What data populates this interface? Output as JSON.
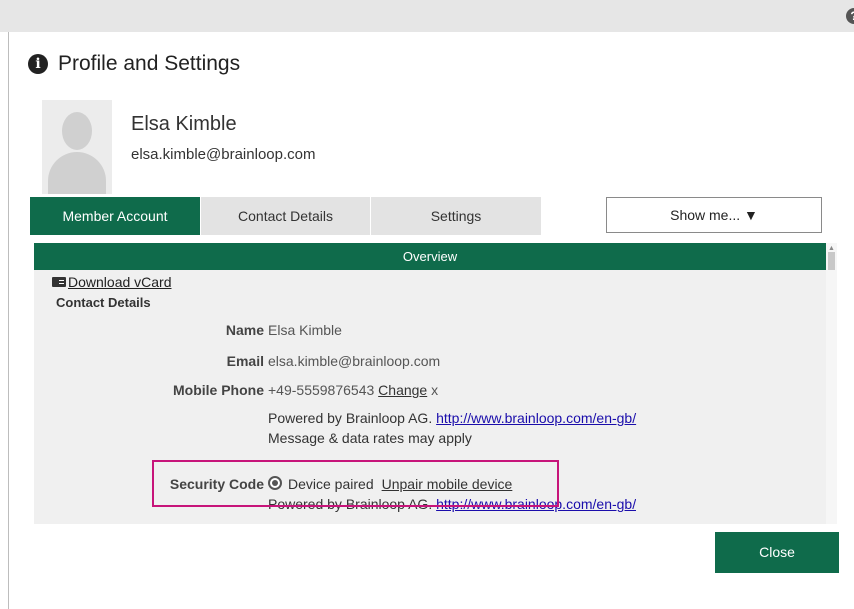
{
  "dialog": {
    "title": "Profile and Settings",
    "help_icon": "?"
  },
  "user": {
    "name": "Elsa Kimble",
    "email": "elsa.kimble@brainloop.com"
  },
  "tabs": [
    {
      "label": "Member Account",
      "active": true
    },
    {
      "label": "Contact Details",
      "active": false
    },
    {
      "label": "Settings",
      "active": false
    }
  ],
  "show_me": {
    "label": "Show me... ▼"
  },
  "panel": {
    "header": "Overview",
    "vcard_label": "Download vCard",
    "section_title": "Contact Details",
    "rows": {
      "name": {
        "label": "Name",
        "value": "Elsa Kimble"
      },
      "email": {
        "label": "Email",
        "value": "elsa.kimble@brainloop.com"
      },
      "mobile": {
        "label": "Mobile Phone",
        "value": "+49-5559876543",
        "change_label": "Change",
        "remove_label": "x"
      },
      "powered_text": "Powered by Brainloop AG.",
      "powered_link": "http://www.brainloop.com/en-gb/",
      "rates_note": "Message & data rates may apply",
      "security": {
        "label": "Security Code",
        "status": "Device paired",
        "unpair_label": "Unpair mobile device"
      }
    }
  },
  "footer": {
    "close_label": "Close"
  },
  "colors": {
    "primary_green": "#0f6b4b",
    "highlight": "#c7147a",
    "link_blue": "#1a0dab"
  }
}
